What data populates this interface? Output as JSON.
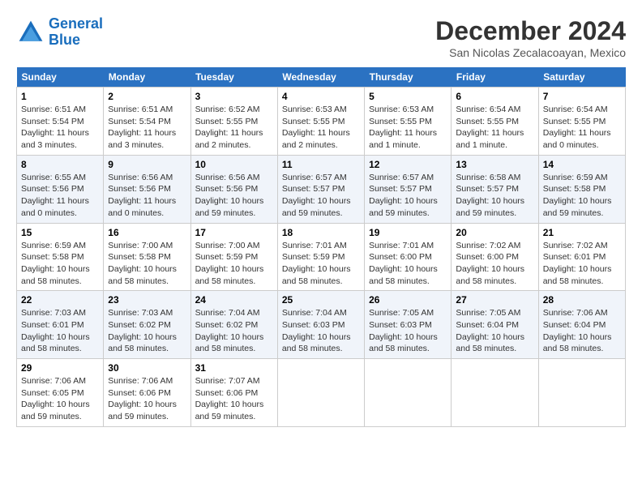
{
  "header": {
    "logo_line1": "General",
    "logo_line2": "Blue",
    "month_title": "December 2024",
    "location": "San Nicolas Zecalacoayan, Mexico"
  },
  "weekdays": [
    "Sunday",
    "Monday",
    "Tuesday",
    "Wednesday",
    "Thursday",
    "Friday",
    "Saturday"
  ],
  "weeks": [
    [
      {
        "day": "1",
        "detail": "Sunrise: 6:51 AM\nSunset: 5:54 PM\nDaylight: 11 hours\nand 3 minutes."
      },
      {
        "day": "2",
        "detail": "Sunrise: 6:51 AM\nSunset: 5:54 PM\nDaylight: 11 hours\nand 3 minutes."
      },
      {
        "day": "3",
        "detail": "Sunrise: 6:52 AM\nSunset: 5:55 PM\nDaylight: 11 hours\nand 2 minutes."
      },
      {
        "day": "4",
        "detail": "Sunrise: 6:53 AM\nSunset: 5:55 PM\nDaylight: 11 hours\nand 2 minutes."
      },
      {
        "day": "5",
        "detail": "Sunrise: 6:53 AM\nSunset: 5:55 PM\nDaylight: 11 hours\nand 1 minute."
      },
      {
        "day": "6",
        "detail": "Sunrise: 6:54 AM\nSunset: 5:55 PM\nDaylight: 11 hours\nand 1 minute."
      },
      {
        "day": "7",
        "detail": "Sunrise: 6:54 AM\nSunset: 5:55 PM\nDaylight: 11 hours\nand 0 minutes."
      }
    ],
    [
      {
        "day": "8",
        "detail": "Sunrise: 6:55 AM\nSunset: 5:56 PM\nDaylight: 11 hours\nand 0 minutes."
      },
      {
        "day": "9",
        "detail": "Sunrise: 6:56 AM\nSunset: 5:56 PM\nDaylight: 11 hours\nand 0 minutes."
      },
      {
        "day": "10",
        "detail": "Sunrise: 6:56 AM\nSunset: 5:56 PM\nDaylight: 10 hours\nand 59 minutes."
      },
      {
        "day": "11",
        "detail": "Sunrise: 6:57 AM\nSunset: 5:57 PM\nDaylight: 10 hours\nand 59 minutes."
      },
      {
        "day": "12",
        "detail": "Sunrise: 6:57 AM\nSunset: 5:57 PM\nDaylight: 10 hours\nand 59 minutes."
      },
      {
        "day": "13",
        "detail": "Sunrise: 6:58 AM\nSunset: 5:57 PM\nDaylight: 10 hours\nand 59 minutes."
      },
      {
        "day": "14",
        "detail": "Sunrise: 6:59 AM\nSunset: 5:58 PM\nDaylight: 10 hours\nand 59 minutes."
      }
    ],
    [
      {
        "day": "15",
        "detail": "Sunrise: 6:59 AM\nSunset: 5:58 PM\nDaylight: 10 hours\nand 58 minutes."
      },
      {
        "day": "16",
        "detail": "Sunrise: 7:00 AM\nSunset: 5:58 PM\nDaylight: 10 hours\nand 58 minutes."
      },
      {
        "day": "17",
        "detail": "Sunrise: 7:00 AM\nSunset: 5:59 PM\nDaylight: 10 hours\nand 58 minutes."
      },
      {
        "day": "18",
        "detail": "Sunrise: 7:01 AM\nSunset: 5:59 PM\nDaylight: 10 hours\nand 58 minutes."
      },
      {
        "day": "19",
        "detail": "Sunrise: 7:01 AM\nSunset: 6:00 PM\nDaylight: 10 hours\nand 58 minutes."
      },
      {
        "day": "20",
        "detail": "Sunrise: 7:02 AM\nSunset: 6:00 PM\nDaylight: 10 hours\nand 58 minutes."
      },
      {
        "day": "21",
        "detail": "Sunrise: 7:02 AM\nSunset: 6:01 PM\nDaylight: 10 hours\nand 58 minutes."
      }
    ],
    [
      {
        "day": "22",
        "detail": "Sunrise: 7:03 AM\nSunset: 6:01 PM\nDaylight: 10 hours\nand 58 minutes."
      },
      {
        "day": "23",
        "detail": "Sunrise: 7:03 AM\nSunset: 6:02 PM\nDaylight: 10 hours\nand 58 minutes."
      },
      {
        "day": "24",
        "detail": "Sunrise: 7:04 AM\nSunset: 6:02 PM\nDaylight: 10 hours\nand 58 minutes."
      },
      {
        "day": "25",
        "detail": "Sunrise: 7:04 AM\nSunset: 6:03 PM\nDaylight: 10 hours\nand 58 minutes."
      },
      {
        "day": "26",
        "detail": "Sunrise: 7:05 AM\nSunset: 6:03 PM\nDaylight: 10 hours\nand 58 minutes."
      },
      {
        "day": "27",
        "detail": "Sunrise: 7:05 AM\nSunset: 6:04 PM\nDaylight: 10 hours\nand 58 minutes."
      },
      {
        "day": "28",
        "detail": "Sunrise: 7:06 AM\nSunset: 6:04 PM\nDaylight: 10 hours\nand 58 minutes."
      }
    ],
    [
      {
        "day": "29",
        "detail": "Sunrise: 7:06 AM\nSunset: 6:05 PM\nDaylight: 10 hours\nand 59 minutes."
      },
      {
        "day": "30",
        "detail": "Sunrise: 7:06 AM\nSunset: 6:06 PM\nDaylight: 10 hours\nand 59 minutes."
      },
      {
        "day": "31",
        "detail": "Sunrise: 7:07 AM\nSunset: 6:06 PM\nDaylight: 10 hours\nand 59 minutes."
      },
      null,
      null,
      null,
      null
    ]
  ]
}
